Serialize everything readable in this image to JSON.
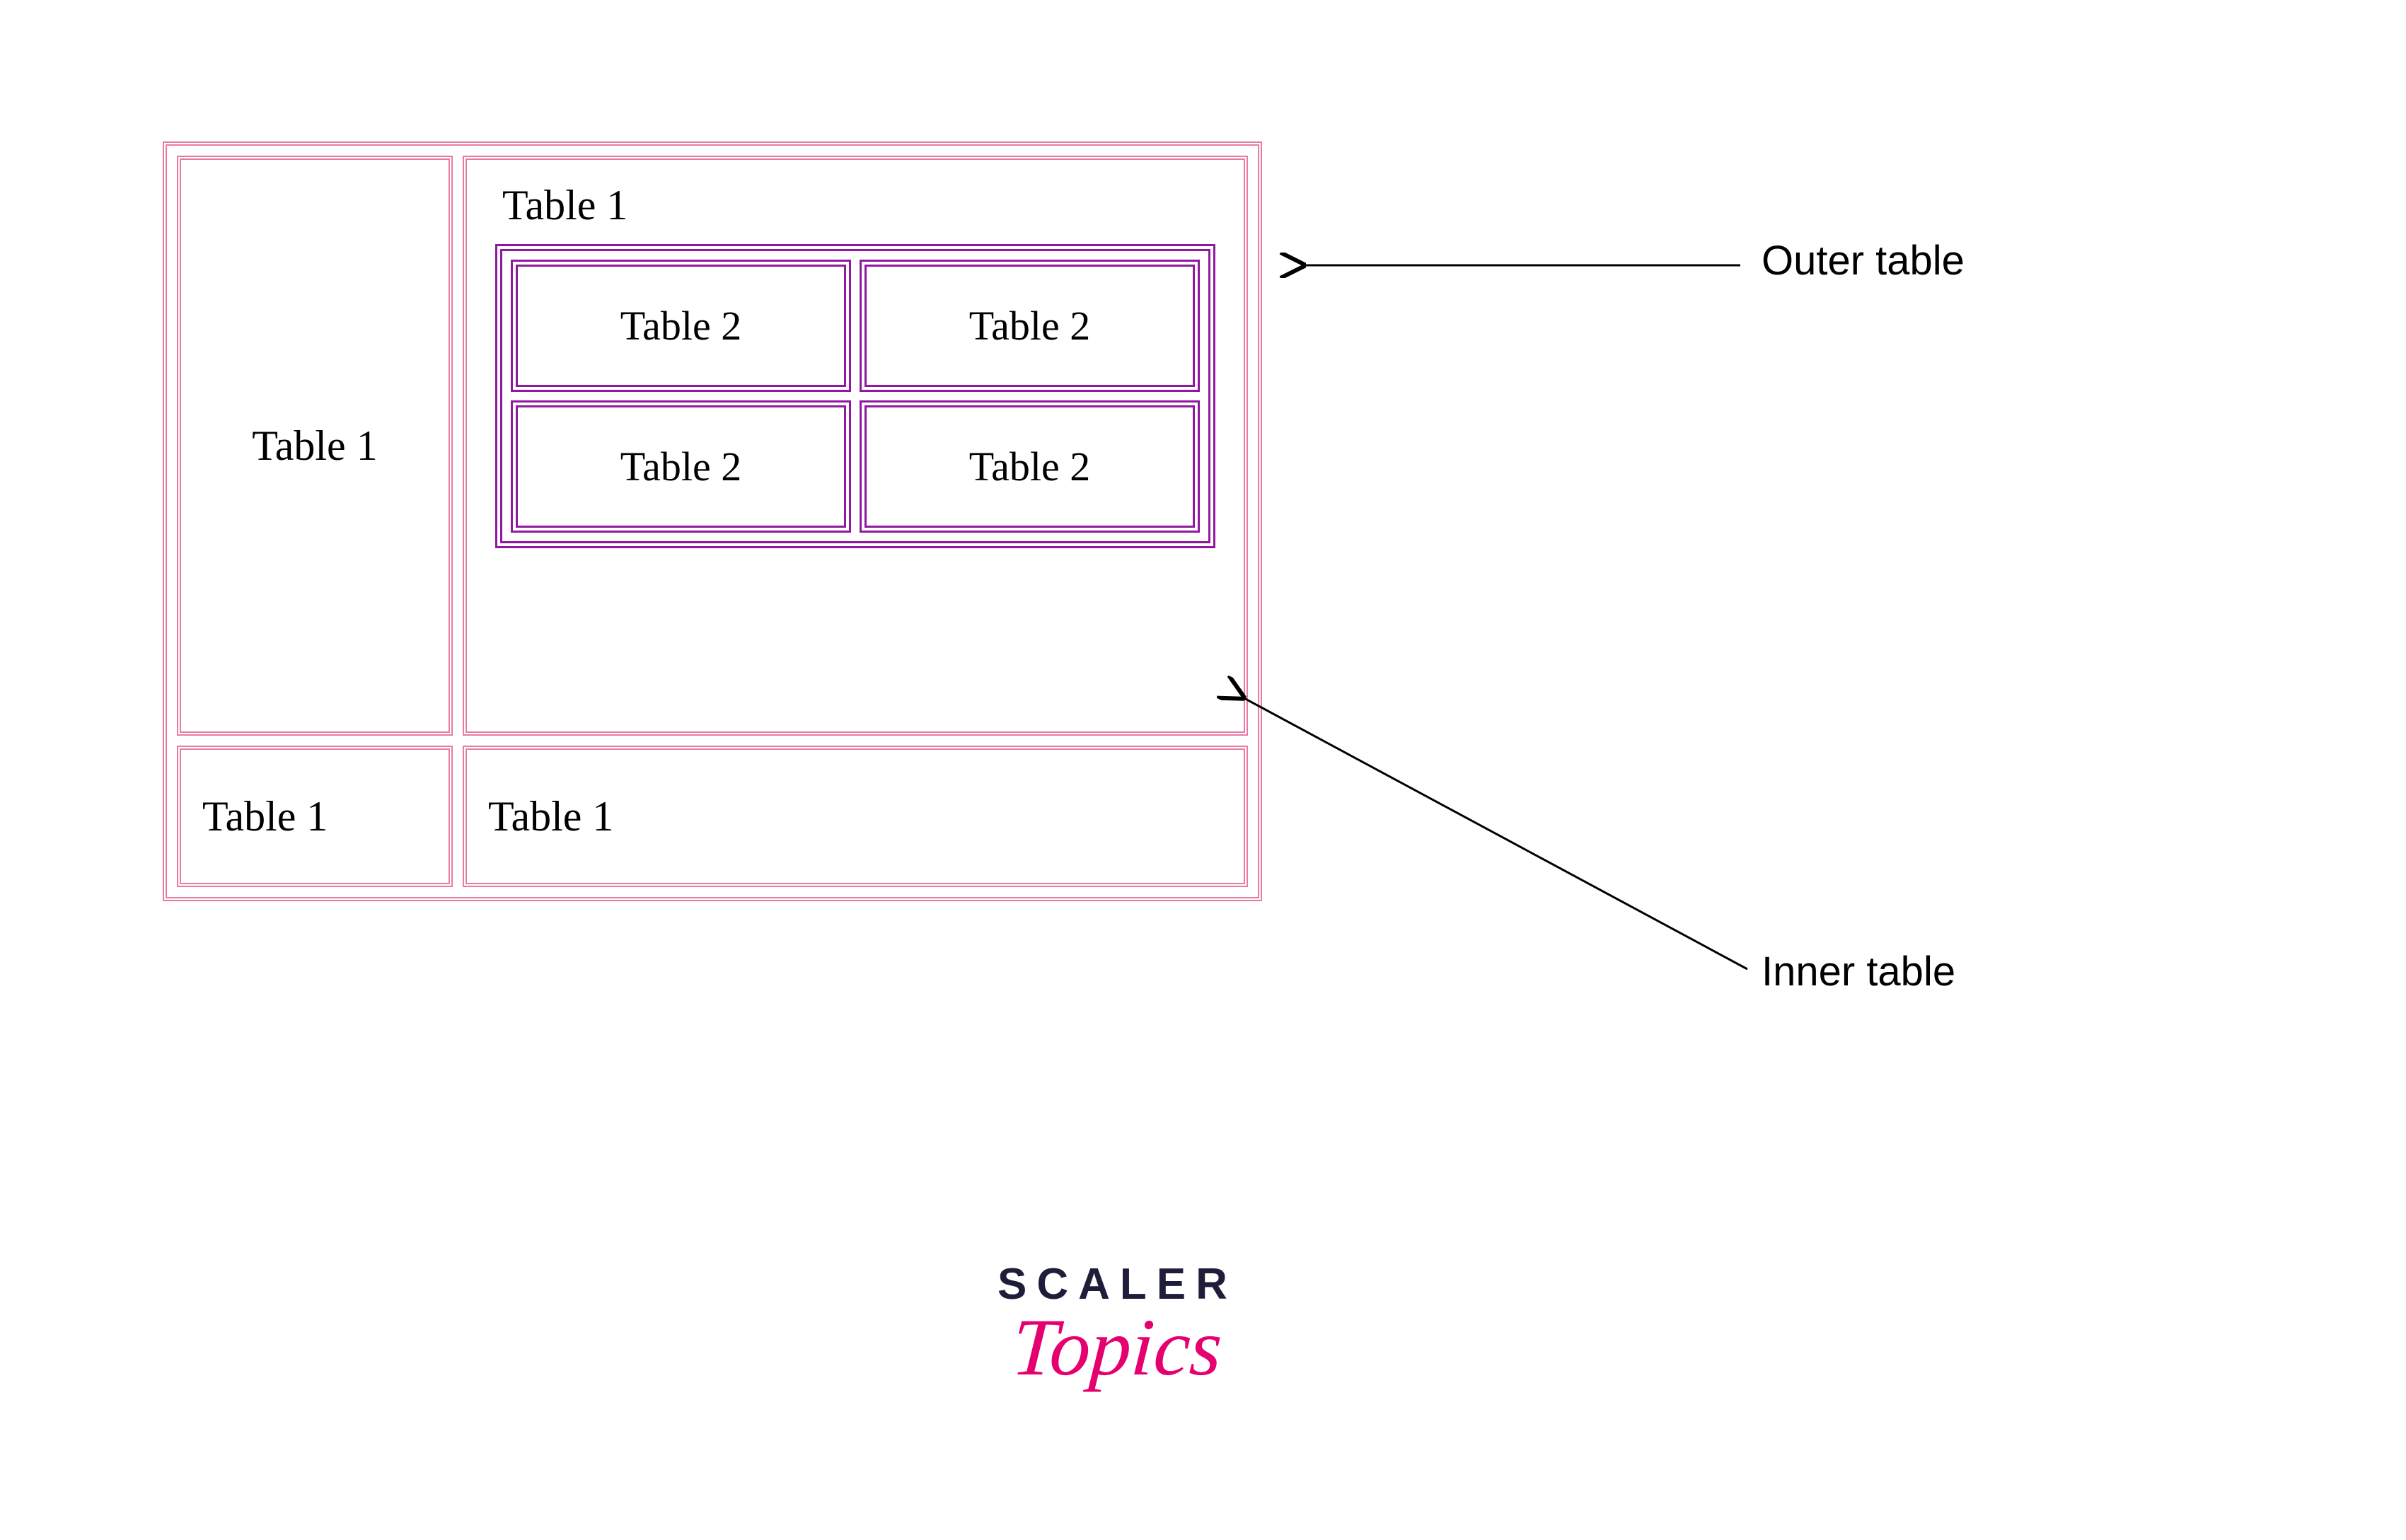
{
  "diagram": {
    "outer": {
      "row1": {
        "leftCell": "Table 1",
        "rightCell": {
          "caption": "Table 1",
          "inner": {
            "r1c1": "Table 2",
            "r1c2": "Table 2",
            "r2c1": "Table 2",
            "r2c2": "Table 2"
          }
        }
      },
      "row2": {
        "leftCell": "Table 1",
        "rightCell": "Table 1"
      }
    }
  },
  "annotations": {
    "outer": "Outer table",
    "inner": "Inner table"
  },
  "colors": {
    "outerBorder": "#e77ba4",
    "innerBorder": "#8e1a9e",
    "brandPink": "#e6006f",
    "brandDark": "#1e1e3a"
  },
  "brand": {
    "line1": "SCALER",
    "line2": "Topics"
  }
}
